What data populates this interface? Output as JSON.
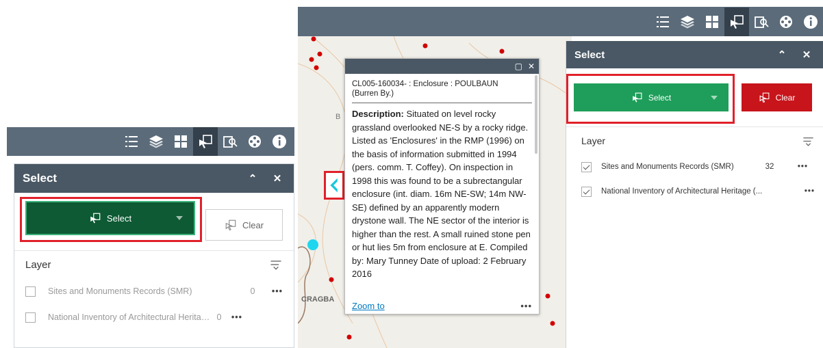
{
  "toolbar_icons": [
    "list-icon",
    "layers-icon",
    "grid-icon",
    "select-icon",
    "query-icon",
    "analysis-icon",
    "info-icon"
  ],
  "left": {
    "panel_title": "Select",
    "select_label": "Select",
    "clear_label": "Clear",
    "layer_label": "Layer",
    "layers": [
      {
        "name": "Sites and Monuments Records (SMR)",
        "count": "0",
        "checked": false
      },
      {
        "name": "National Inventory of Architectural Heritage (...",
        "count": "0",
        "checked": false
      }
    ]
  },
  "right": {
    "panel_title": "Select",
    "select_label": "Select",
    "clear_label": "Clear",
    "layer_label": "Layer",
    "layers": [
      {
        "name": "Sites and Monuments Records (SMR)",
        "count": "32",
        "checked": true
      },
      {
        "name": "National Inventory of Architectural Heritage (...",
        "count": "",
        "checked": true
      }
    ]
  },
  "map_labels": [
    "CRAGBA",
    "B"
  ],
  "popup": {
    "title": "CL005-160034- : Enclosure : POULBAUN (Burren By.)",
    "desc_label": "Description:",
    "description": " Situated on level rocky grassland overlooked NE-S by a rocky ridge. Listed as 'Enclosures' in the RMP (1996) on the basis of information submitted in 1994 (pers. comm. T. Coffey). On inspection in 1998 this was found to be a subrectangular enclosure (int. diam. 16m NE-SW; 14m NW-SE) defined by an apparently modern drystone wall. The NE sector of the interior is higher than the rest. A small ruined stone pen or hut lies 5m from enclosure at E. Compiled by: Mary Tunney Date of upload: 2 February 2016",
    "zoom_label": "Zoom to"
  },
  "colors": {
    "toolbar": "#5b6b7a",
    "header": "#4a5865",
    "select_dark": "#0d5a34",
    "select_green": "#1e9e5a",
    "clear_red": "#c8141b",
    "highlight": "#e0202a"
  }
}
